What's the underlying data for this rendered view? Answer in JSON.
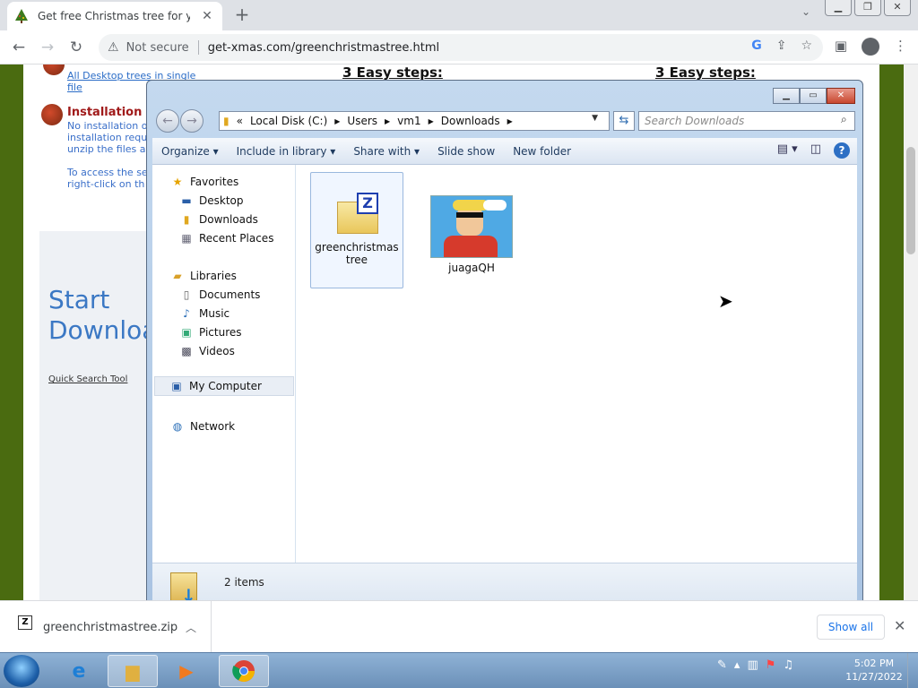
{
  "browser": {
    "tab_title": "Get free Christmas tree for your d",
    "not_secure": "Not secure",
    "url": "get-xmas.com/greenchristmastree.html"
  },
  "webpage": {
    "step_left": "3 Easy steps:",
    "step_right": "3 Easy steps:",
    "desktop_link": "All Desktop trees in single file",
    "installation_title": "Installation",
    "installation_body": "No installation o installation requ unzip the files a",
    "access_body": "To access the se right-click on th",
    "promo_big": "Start Downloa",
    "quick_search": "Quick Search Tool"
  },
  "explorer": {
    "address": {
      "chevron": "«",
      "parts": [
        "Local Disk (C:)",
        "Users",
        "vm1",
        "Downloads"
      ]
    },
    "search_placeholder": "Search Downloads",
    "commands": [
      "Organize",
      "Include in library",
      "Share with",
      "Slide show",
      "New folder"
    ],
    "nav": {
      "favorites": "Favorites",
      "desktop": "Desktop",
      "downloads": "Downloads",
      "recent": "Recent Places",
      "libraries": "Libraries",
      "documents": "Documents",
      "music": "Music",
      "pictures": "Pictures",
      "videos": "Videos",
      "computer": "My Computer",
      "network": "Network"
    },
    "files": [
      {
        "name": "greenchristmastree",
        "type": "zip"
      },
      {
        "name": "juagaQH",
        "type": "image"
      }
    ],
    "status_count": "2 items"
  },
  "download_bar": {
    "file": "greenchristmastree.zip",
    "show_all": "Show all"
  },
  "taskbar": {
    "time": "5:02 PM",
    "date": "11/27/2022"
  }
}
